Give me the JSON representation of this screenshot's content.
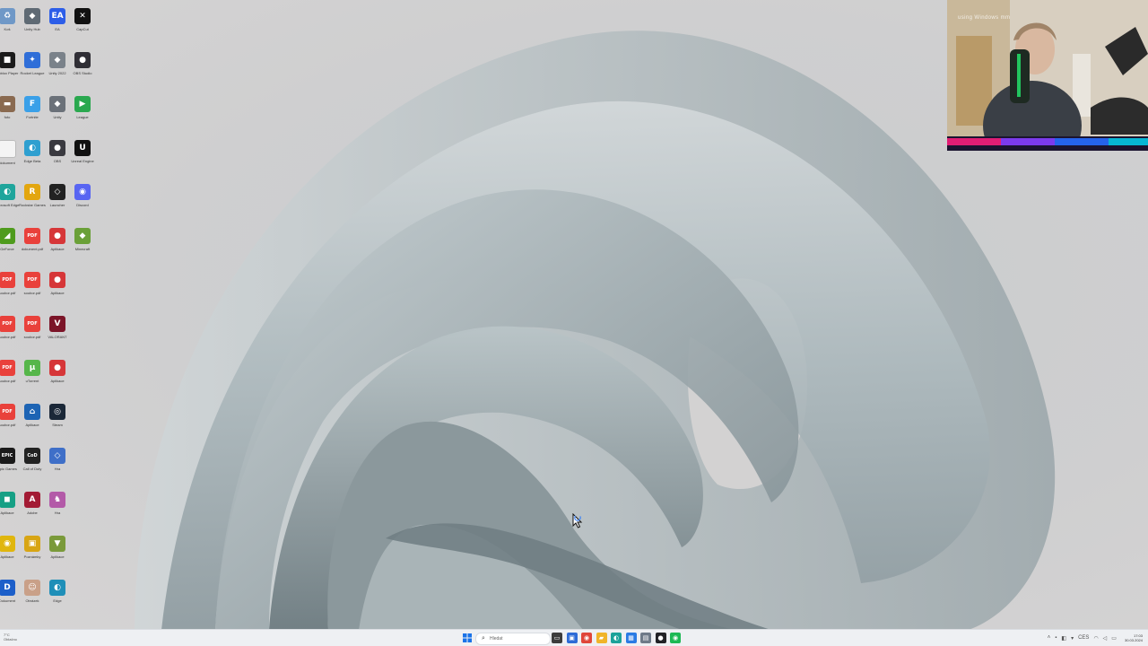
{
  "desktop": {
    "icons": [
      {
        "name": "recycle-bin-icon",
        "label": "Koš",
        "glyph": "♻",
        "color": "#6f98c7"
      },
      {
        "name": "unity-hub-icon",
        "label": "Unity Hub",
        "glyph": "◆",
        "color": "#5f6a74"
      },
      {
        "name": "ea-app-icon",
        "label": "EA",
        "glyph": "EA",
        "color": "#2d5ee8"
      },
      {
        "name": "capcut-icon",
        "label": "CapCut",
        "glyph": "✕",
        "color": "#111111"
      },
      {
        "name": "roblox-player-icon",
        "label": "Roblox Player",
        "glyph": "■",
        "color": "#1b1b1b"
      },
      {
        "name": "rocket-league-icon",
        "label": "Rocket League",
        "glyph": "✦",
        "color": "#2f6ed8"
      },
      {
        "name": "unity-project-icon",
        "label": "Unity 2022",
        "glyph": "◆",
        "color": "#7a828a"
      },
      {
        "name": "obs-studio-icon",
        "label": "OBS Studio",
        "glyph": "●",
        "color": "#302f36"
      },
      {
        "name": "photo-file-icon",
        "label": "foto",
        "glyph": "▬",
        "color": "#8a6a50"
      },
      {
        "name": "fortnite-icon",
        "label": "Fortnite",
        "glyph": "F",
        "color": "#3aa0e8"
      },
      {
        "name": "unity-editor-icon",
        "label": "Unity",
        "glyph": "◆",
        "color": "#6b7179"
      },
      {
        "name": "lol-icon",
        "label": "League",
        "glyph": "▶",
        "color": "#2aa84f"
      },
      {
        "name": "text-file-icon",
        "label": "dokument",
        "glyph": "",
        "color": "#f4f4f4"
      },
      {
        "name": "edge-beta-icon",
        "label": "Edge Beta",
        "glyph": "◐",
        "color": "#2e9fd0"
      },
      {
        "name": "obs-portable-icon",
        "label": "OBS",
        "glyph": "●",
        "color": "#3a3a40"
      },
      {
        "name": "unreal-engine-icon",
        "label": "Unreal Engine",
        "glyph": "U",
        "color": "#111111"
      },
      {
        "name": "edge-icon",
        "label": "Microsoft Edge",
        "glyph": "◐",
        "color": "#1fa59c"
      },
      {
        "name": "rockstar-icon",
        "label": "Rockstar Games",
        "glyph": "R",
        "color": "#e3a60f"
      },
      {
        "name": "game-launcher-icon",
        "label": "Launcher",
        "glyph": "◇",
        "color": "#222222"
      },
      {
        "name": "discord-icon",
        "label": "Discord",
        "glyph": "◉",
        "color": "#5865f2"
      },
      {
        "name": "nvidia-icon",
        "label": "GeForce",
        "glyph": "◢",
        "color": "#4f9b1d"
      },
      {
        "name": "pdf-file-icon",
        "label": "dokument.pdf",
        "glyph": "PDF",
        "color": "#e9413b"
      },
      {
        "name": "red-app-icon",
        "label": "Aplikace",
        "glyph": "●",
        "color": "#d63638"
      },
      {
        "name": "minecraft-icon",
        "label": "Minecraft",
        "glyph": "◆",
        "color": "#6aa038"
      },
      {
        "name": "pdf-file-icon",
        "label": "soubor.pdf",
        "glyph": "PDF",
        "color": "#e9413b"
      },
      {
        "name": "pdf-file-icon",
        "label": "soubor.pdf",
        "glyph": "PDF",
        "color": "#e9413b"
      },
      {
        "name": "red-app-icon",
        "label": "Aplikace",
        "glyph": "●",
        "color": "#d63638"
      },
      {
        "name": "pdf-file-icon",
        "label": "soubor.pdf",
        "glyph": "PDF",
        "color": "#e9413b"
      },
      {
        "name": "pdf-file-icon",
        "label": "soubor.pdf",
        "glyph": "PDF",
        "color": "#e9413b"
      },
      {
        "name": "valorant-icon",
        "label": "VALORANT",
        "glyph": "V",
        "color": "#7b1428"
      },
      {
        "name": "pdf-file-icon",
        "label": "soubor.pdf",
        "glyph": "PDF",
        "color": "#e9413b"
      },
      {
        "name": "utorrent-icon",
        "label": "uTorrent",
        "glyph": "µ",
        "color": "#56b64a"
      },
      {
        "name": "red-app-icon",
        "label": "Aplikace",
        "glyph": "●",
        "color": "#d63638"
      },
      {
        "name": "pdf-file-icon",
        "label": "soubor.pdf",
        "glyph": "PDF",
        "color": "#e9413b"
      },
      {
        "name": "xbox-app-icon",
        "label": "Aplikace",
        "glyph": "⌂",
        "color": "#1d64b4"
      },
      {
        "name": "steam-icon",
        "label": "Steam",
        "glyph": "◎",
        "color": "#1b2838"
      },
      {
        "name": "epic-games-icon",
        "label": "Epic Games",
        "glyph": "EPIC",
        "color": "#1a1a1a"
      },
      {
        "name": "call-of-duty-icon",
        "label": "Call of Duty",
        "glyph": "CoD",
        "color": "#222222"
      },
      {
        "name": "overwatch-icon",
        "label": "Hra",
        "glyph": "◇",
        "color": "#3f6fc8"
      },
      {
        "name": "green-app-icon",
        "label": "Aplikace",
        "glyph": "◼",
        "color": "#16a085"
      },
      {
        "name": "adobe-icon",
        "label": "Adobe",
        "glyph": "A",
        "color": "#a31b34"
      },
      {
        "name": "fall-guys-icon",
        "label": "Hra",
        "glyph": "♞",
        "color": "#b35aa8"
      },
      {
        "name": "yellow-app-icon",
        "label": "Aplikace",
        "glyph": "◉",
        "color": "#e0b60e"
      },
      {
        "name": "notes-icon",
        "label": "Poznámky",
        "glyph": "▣",
        "color": "#d8a514"
      },
      {
        "name": "mod-tool-icon",
        "label": "Aplikace",
        "glyph": "▼",
        "color": "#7a9a3a"
      },
      {
        "name": "blue-doc-icon",
        "label": "Dokument",
        "glyph": "D",
        "color": "#1d5fc9"
      },
      {
        "name": "person-file-icon",
        "label": "Obrázek",
        "glyph": "☺",
        "color": "#c9a088"
      },
      {
        "name": "edge-dev-icon",
        "label": "Edge",
        "glyph": "◐",
        "color": "#1f8fb8"
      }
    ]
  },
  "webcam": {
    "overlay_text": "using  Windows  mm"
  },
  "taskbar": {
    "weather_temp": "7°C",
    "weather_desc": "Oblačno",
    "search_placeholder": "Hledat",
    "pinned": [
      {
        "name": "task-view-icon",
        "glyph": "▭",
        "color": "#3c3c3c"
      },
      {
        "name": "taskbar-app-icon",
        "glyph": "▣",
        "color": "#2d6bd6"
      },
      {
        "name": "chrome-icon",
        "glyph": "◉",
        "color": "#e0463a"
      },
      {
        "name": "file-explorer-icon",
        "glyph": "▰",
        "color": "#f0b429"
      },
      {
        "name": "edge-icon",
        "glyph": "◐",
        "color": "#1ba29a"
      },
      {
        "name": "store-icon",
        "glyph": "▦",
        "color": "#2a7be4"
      },
      {
        "name": "taskbar-app-icon",
        "glyph": "▤",
        "color": "#6e7a88"
      },
      {
        "name": "obs-icon",
        "glyph": "●",
        "color": "#222226"
      },
      {
        "name": "spotify-icon",
        "glyph": "◉",
        "color": "#1db954"
      }
    ],
    "tray": {
      "language": "CES",
      "time": "17:03",
      "date": "30.03.2024"
    }
  }
}
